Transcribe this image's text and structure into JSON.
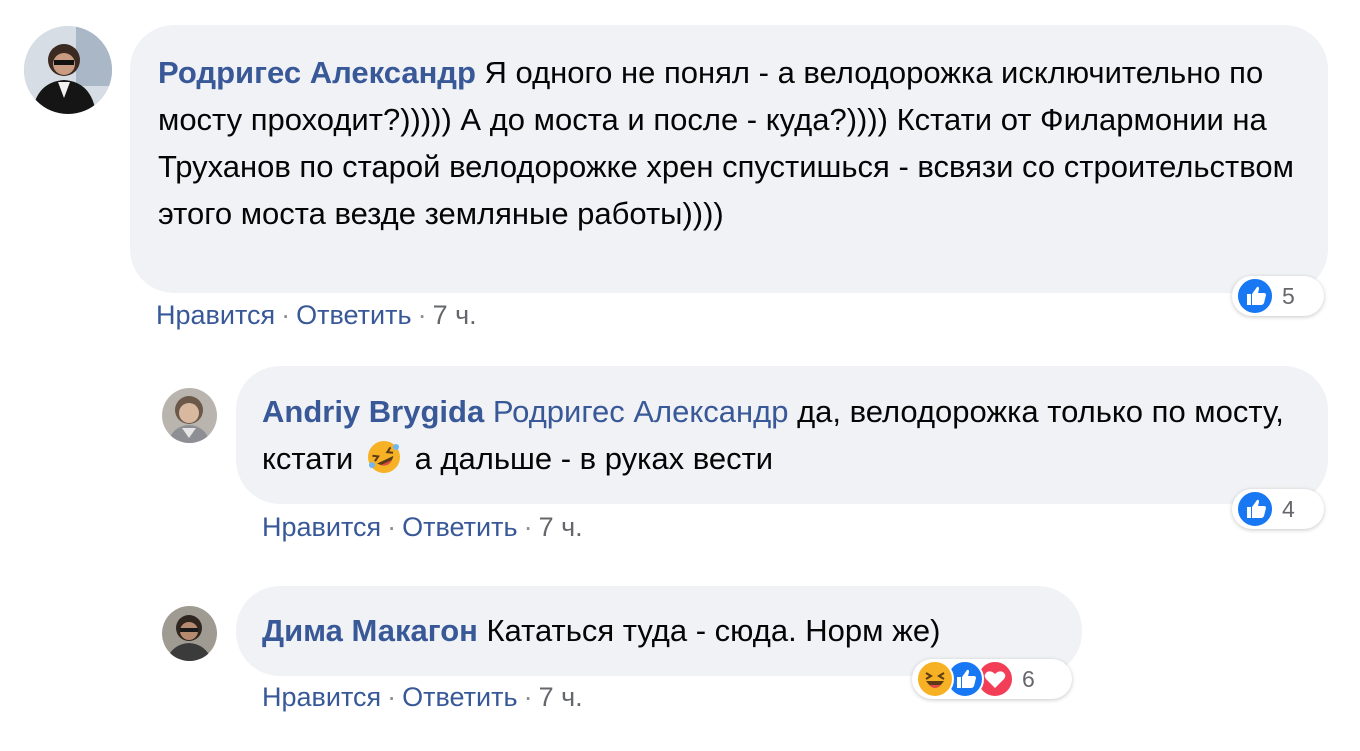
{
  "comments": [
    {
      "author": "Родригес Александр",
      "text": " Я одного не понял - а велодорожка исключительно по мосту проходит?))))) А до моста и после - куда?)))) Кстати от Филармонии на Труханов по старой велодорожке хрен спустишься - всвязи со строительством этого моста везде земляные работы))))",
      "like_label": "Нравится",
      "reply_label": "Ответить",
      "time": "7 ч.",
      "reaction_count": "5",
      "reaction_icons": [
        "like-icon"
      ]
    },
    {
      "author": "Andriy Brygida",
      "mention": "Родригес Александр",
      "text_before_emoji": " да, велодорожка только по мосту, кстати ",
      "emoji": "rolling-laughing-emoji",
      "text_after_emoji": " а дальше - в руках вести",
      "like_label": "Нравится",
      "reply_label": "Ответить",
      "time": "7 ч.",
      "reaction_count": "4",
      "reaction_icons": [
        "like-icon"
      ]
    },
    {
      "author": "Дима Макагон",
      "text": " Кататься туда - сюда. Норм же)",
      "like_label": "Нравится",
      "reply_label": "Ответить",
      "time": "7 ч.",
      "reaction_count": "6",
      "reaction_icons": [
        "haha-icon",
        "like-icon",
        "love-icon"
      ]
    }
  ],
  "colors": {
    "bubble_bg": "#f0f2f5",
    "link": "#385898",
    "like_blue": "#1877f2",
    "love_red": "#f33e58",
    "haha_yellow": "#f7b125"
  }
}
